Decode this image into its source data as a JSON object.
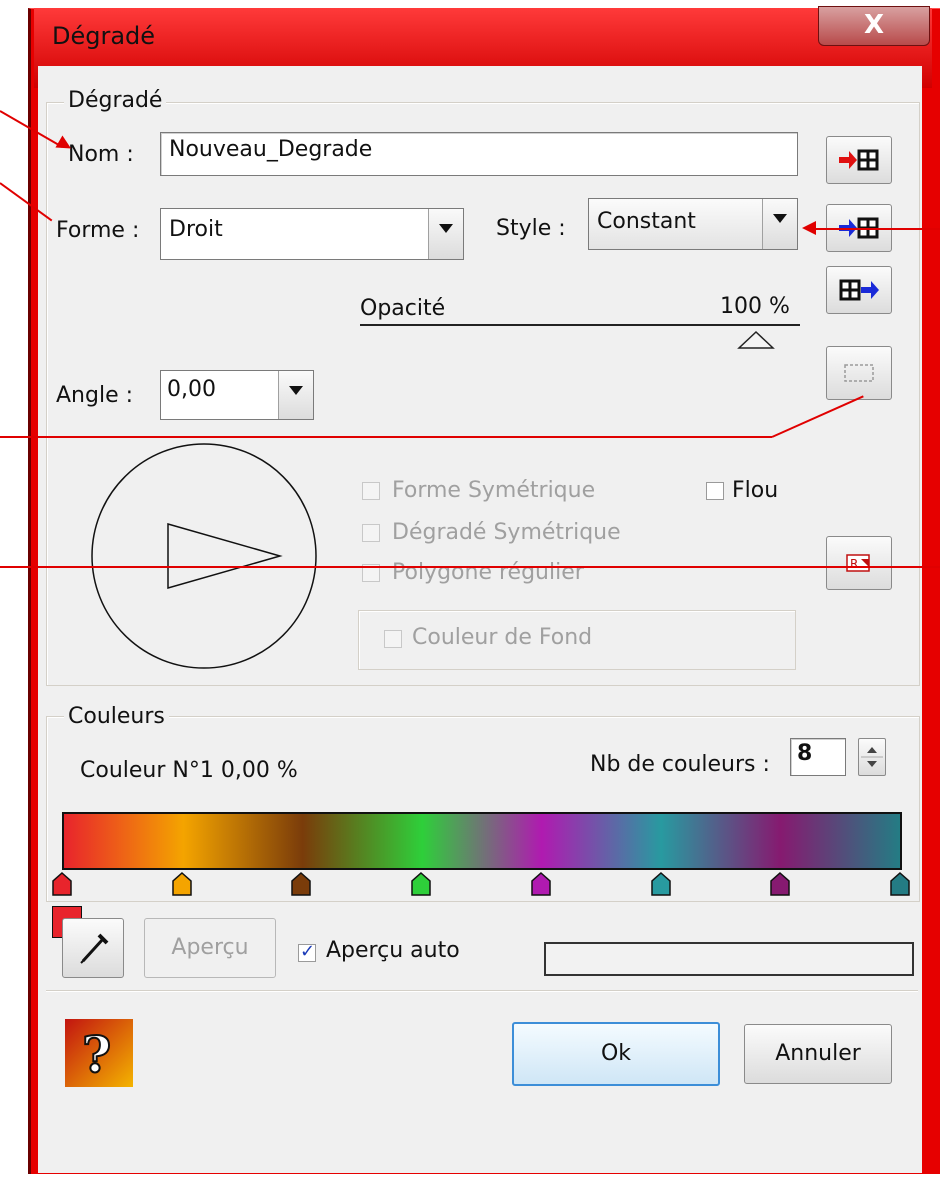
{
  "window": {
    "title": "Dégradé",
    "close_glyph": "X"
  },
  "gradient_group": {
    "legend": "Dégradé",
    "name_label": "Nom :",
    "name_value": "Nouveau_Degrade",
    "shape_label": "Forme :",
    "shape_value": "Droit",
    "style_label": "Style :",
    "style_value": "Constant",
    "opacity_label": "Opacité",
    "opacity_value": "100 %",
    "opacity_level": 0.9,
    "angle_label": "Angle :",
    "angle_value": "0,00",
    "options": {
      "symmetric_shape": "Forme Symétrique",
      "blur": "Flou",
      "symmetric_gradient": "Dégradé Symétrique",
      "regular_polygon": "Polygone régulier",
      "background_color": "Couleur de Fond"
    }
  },
  "colors_group": {
    "legend": "Couleurs",
    "current_color": "Couleur N°1 0,00 %",
    "count_label": "Nb de couleurs :",
    "count_value": "8",
    "stops": [
      "#e8242c",
      "#f4a400",
      "#7a3c0a",
      "#2ecf3a",
      "#b01ab0",
      "#289aa0",
      "#861a70",
      "#247c84"
    ],
    "selected_color": "#e8242c"
  },
  "bottom": {
    "preview_button": "Aperçu",
    "auto_preview_label": "Aperçu auto",
    "auto_preview_checked": true,
    "ok_button": "Ok",
    "cancel_button": "Annuler"
  },
  "icons": {
    "save_gradient": "save-to-list-icon",
    "load_gradient": "load-from-list-icon",
    "export_gradient": "export-icon",
    "selection_rect": "dashed-rect-icon",
    "reset": "reset-icon",
    "picker": "eyedropper-icon",
    "help": "help-icon"
  },
  "colors": {
    "frame": "#e60000",
    "annotation": "#e00000"
  }
}
